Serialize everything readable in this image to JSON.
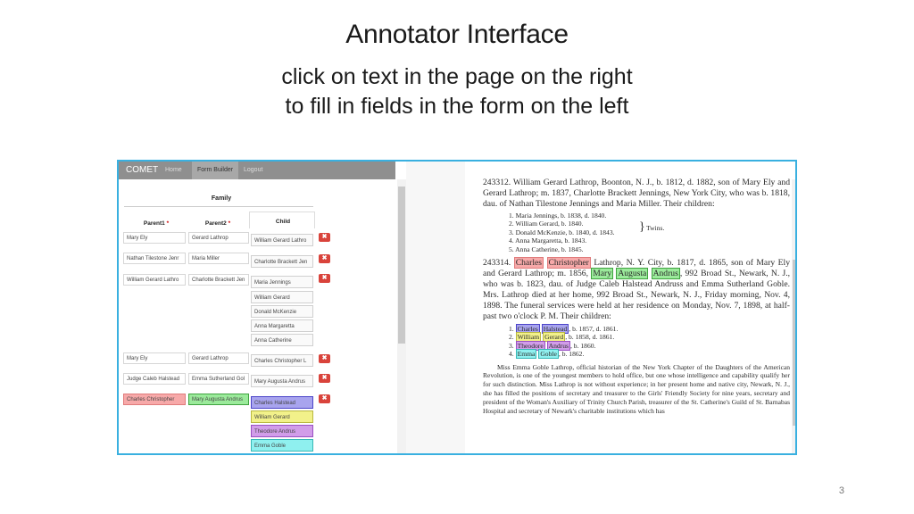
{
  "slide": {
    "title": "Annotator Interface",
    "subtitle_1": "click on text in the page on the right",
    "subtitle_2": "to fill in fields in the form on the left",
    "page_number": "3"
  },
  "app": {
    "brand": "COMET",
    "nav": [
      "Home",
      "Form Builder",
      "Logout"
    ]
  },
  "form": {
    "family_label": "Family",
    "parent1_label": "Parent1",
    "parent2_label": "Parent2",
    "required_mark": "*",
    "child_label": "Child",
    "delete_label": "✖",
    "rows": [
      {
        "parent1": "Mary Ely",
        "parent2": "Gerard Lathrop",
        "children": [
          "William Gerard Lathro"
        ]
      },
      {
        "parent1": "Nathan Tilestone Jenr",
        "parent2": "Maria Miller",
        "children": [
          "Charlotte Brackett Jen"
        ]
      },
      {
        "parent1": "William Gerard Lathro",
        "parent2": "Charlotte Brackett Jen",
        "children": [
          "Maria Jennings",
          "William Gerard",
          "Donald McKenzie",
          "Anna Margaretta",
          "Anna Catherine"
        ]
      },
      {
        "parent1": "Mary Ely",
        "parent2": "Gerard Lathrop",
        "children": [
          "Charles Christopher L"
        ]
      },
      {
        "parent1": "Judge Caleb Halstead",
        "parent2": "Emma Sutherland Gol",
        "children": [
          "Mary Augusta Andrus"
        ]
      },
      {
        "parent1": "Charles Christopher",
        "parent2": "Mary Augusta Andrus",
        "children": [
          "Charles Halstead",
          "William Gerard",
          "Theodore Andrus",
          "Emma Goble"
        ]
      }
    ]
  },
  "colors": {
    "frame": "#39b0e0",
    "red_highlight": "#f7a9a9",
    "green_highlight": "#9bea9b",
    "blue_highlight": "#a8a4ee",
    "yellow_highlight": "#f2f18a",
    "violet_highlight": "#d19de9",
    "cyan_highlight": "#8ff0ef",
    "delete_button": "#d9433b"
  },
  "doc": {
    "e1": {
      "p1": "243312. William Gerard Lathrop, Boonton, N. J., b. 1812, d. 1882, son of Mary Ely and Gerard Lathrop; m. 1837, Charlotte Brackett Jennings, New York City, who was b. 1818, dau. of Nathan Tilestone Jennings and Maria Miller. Their children:",
      "l1": "1. Maria Jennings, b. 1838, d. 1840.",
      "l2": "2. William Gerard, b. 1840.",
      "l3": "3. Donald McKenzie, b. 1840, d. 1843.",
      "twins": "Twins.",
      "l4": "4. Anna Margaretta, b. 1843.",
      "l5": "5. Anna Catherine, b. 1845."
    },
    "e2": {
      "num": "243314.",
      "charles": "Charles",
      "christopher": "Christopher",
      "t1": "Lathrop, N. Y. City, b. 1817, d. 1865, son of Mary Ely and Gerard Lathrop; m. 1856,",
      "mary": "Mary",
      "augusta": "Augusta",
      "andrus": "Andrus",
      "t2": ", 992 Broad St., Newark, N. J., who was b. 1823, dau. of Judge Caleb Halstead Andruss and Emma Sutherland Goble. Mrs. Lathrop died at her home, 992 Broad St., Newark, N. J., Friday morning, Nov. 4, 1898. The funeral services were held at her residence on Monday, Nov. 7, 1898, at half-past two o'clock P. M. Their children:",
      "c1a": "Charles",
      "c1b": "Halstead",
      "c1r": ", b. 1857, d. 1861.",
      "c2a": "William",
      "c2b": "Gerard",
      "c2r": ", b. 1858, d. 1861.",
      "c3a": "Theodore",
      "c3b": "Andrus",
      "c3r": ", b. 1860.",
      "c4a": "Emma",
      "c4b": "Goble",
      "c4r": ", b. 1862.",
      "p3": "Miss Emma Goble Lathrop, official historian of the New York Chapter of the Daughters of the American Revolution, is one of the youngest members to hold office, but one whose intelligence and capability qualify her for such distinction. Miss Lathrop is not without experience; in her present home and native city, Newark, N. J., she has filled the positions of secretary and treasurer to the Girls' Friendly Society for nine years, secretary and president of the Woman's Auxiliary of Trinity Church Parish, treasurer of the St. Catherine's Guild of St. Barnabas Hospital and secretary of Newark's charitable institutions which has"
    }
  }
}
